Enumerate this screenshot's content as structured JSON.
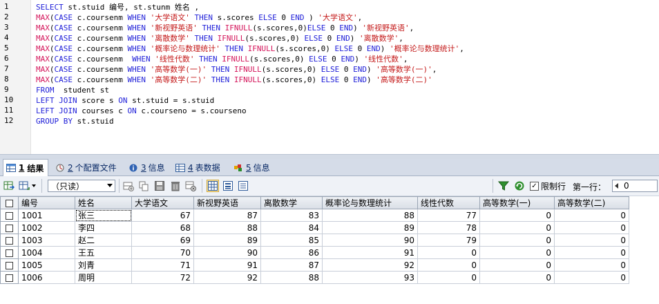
{
  "editor": {
    "line_numbers": [
      "1",
      "2",
      "3",
      "4",
      "5",
      "6",
      "7",
      "8",
      "9",
      "10",
      "11",
      "12"
    ]
  },
  "tabs": [
    {
      "num": "1",
      "label": "结果",
      "active": true
    },
    {
      "num": "2",
      "label": "个配置文件"
    },
    {
      "num": "3",
      "label": "信息"
    },
    {
      "num": "4",
      "label": "表数据"
    },
    {
      "num": "5",
      "label": "信息"
    }
  ],
  "toolbar": {
    "mode_value": "（只读）",
    "limit_rows_label": "限制行",
    "first_row_label": "第一行：",
    "first_row_value": "0"
  },
  "colors": {
    "accent": "#d5dce8",
    "keyword": "#1d1dd8",
    "function": "#d4145a",
    "string": "#c41a1a"
  },
  "grid": {
    "columns": [
      "编号",
      "姓名",
      "大学语文",
      "新视野英语",
      "离散数学",
      "概率论与数理统计",
      "线性代数",
      "高等数学(一)",
      "高等数学(二)"
    ],
    "rows": [
      [
        "1001",
        "张三",
        "67",
        "87",
        "83",
        "88",
        "77",
        "0",
        "0"
      ],
      [
        "1002",
        "李四",
        "68",
        "88",
        "84",
        "89",
        "78",
        "0",
        "0"
      ],
      [
        "1003",
        "赵二",
        "69",
        "89",
        "85",
        "90",
        "79",
        "0",
        "0"
      ],
      [
        "1004",
        "王五",
        "70",
        "90",
        "86",
        "91",
        "0",
        "0",
        "0"
      ],
      [
        "1005",
        "刘青",
        "71",
        "91",
        "87",
        "92",
        "0",
        "0",
        "0"
      ],
      [
        "1006",
        "周明",
        "72",
        "92",
        "88",
        "93",
        "0",
        "0",
        "0"
      ]
    ]
  }
}
